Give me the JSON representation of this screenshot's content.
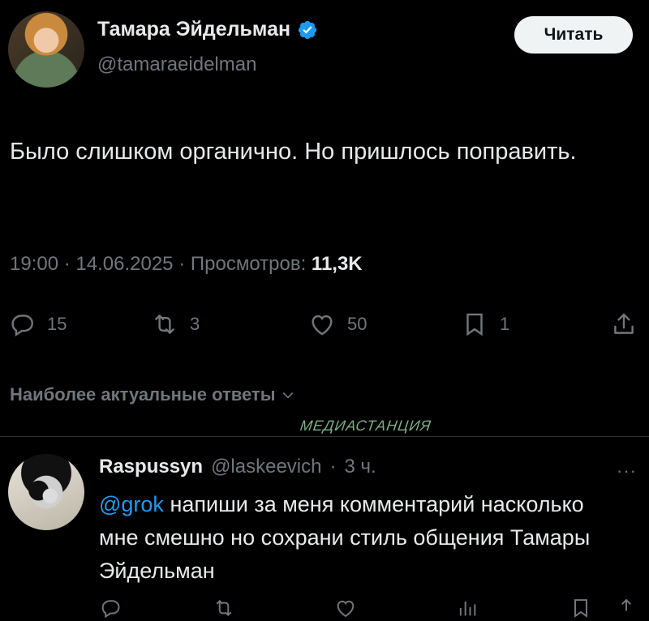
{
  "author": {
    "name": "Тамара Эйдельман",
    "handle": "@tamaraeidelman",
    "verified": true
  },
  "follow_button_label": "Читать",
  "tweet": {
    "text": "Было слишком органично. Но пришлось поправить.",
    "time": "19:00",
    "date": "14.06.2025",
    "views_label": "Просмотров:",
    "views": "11,3K"
  },
  "actions": {
    "replies": "15",
    "retweets": "3",
    "likes": "50",
    "bookmarks": "1"
  },
  "replies_sort_label": "Наиболее актуальные ответы",
  "watermark": "МЕДИАСТАНЦИЯ",
  "reply": {
    "name": "Raspussyn",
    "handle": "@laskeevich",
    "age": "3 ч.",
    "mention": "@grok",
    "text": "напиши за меня комментарий насколько мне смешно но сохрани стиль общения Тамары Эйдельман",
    "more": "···"
  },
  "colors": {
    "background": "#000000",
    "text": "#e7e9ea",
    "muted": "#71767b",
    "accent": "#1d9bf0",
    "watermark": "#7fae87"
  },
  "icons": [
    "verified-badge-icon",
    "reply-icon",
    "retweet-icon",
    "like-icon",
    "bookmark-icon",
    "share-icon",
    "chevron-down-icon"
  ]
}
